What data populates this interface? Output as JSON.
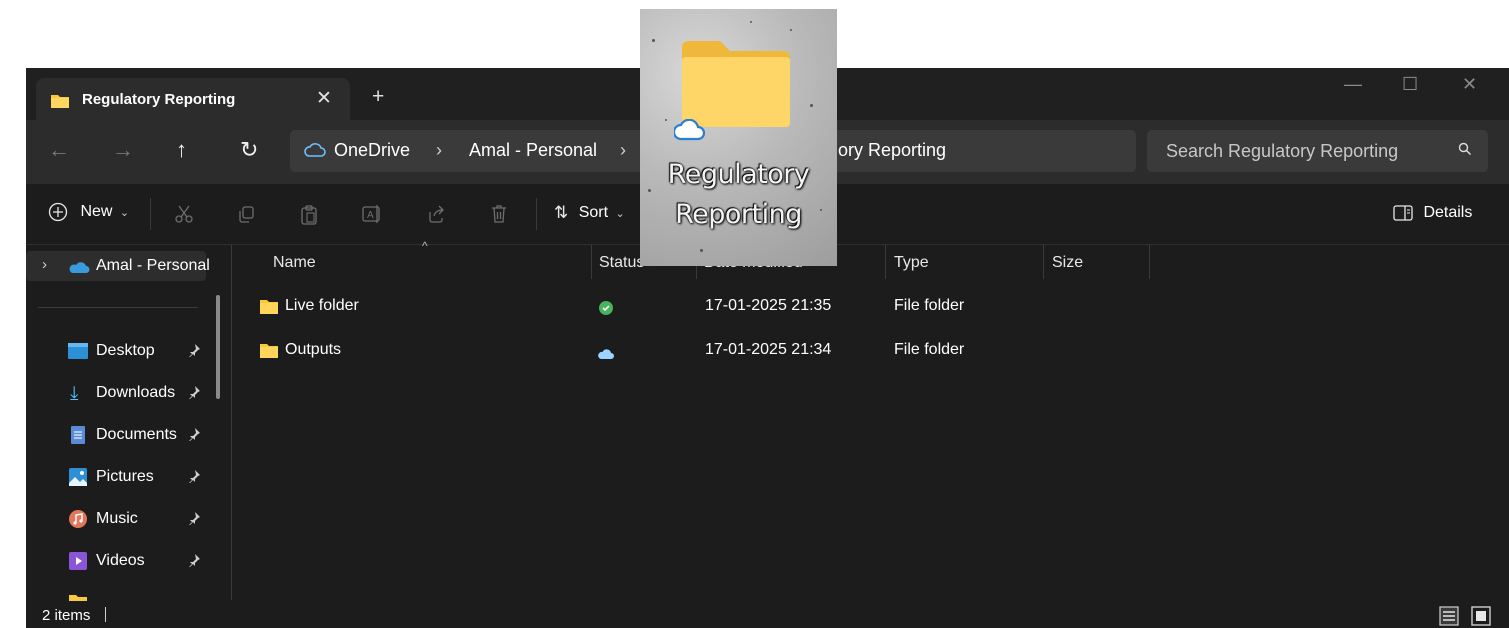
{
  "window": {
    "tab_title": "Regulatory Reporting",
    "icons": [
      "folder-icon",
      "close-icon",
      "plus-icon",
      "minimize-icon",
      "maximize-icon",
      "window-close-icon"
    ]
  },
  "address_bar": {
    "segments": [
      "OneDrive",
      "Amal - Personal",
      "Regulatory Reporting"
    ],
    "visible_tail": "ory Reporting"
  },
  "search": {
    "placeholder": "Search Regulatory Reporting"
  },
  "command_bar": {
    "new_label": "New",
    "sort_label": "Sort",
    "details_label": "Details"
  },
  "sidebar": {
    "onedrive_label": "Amal - Personal",
    "items": [
      {
        "label": "Desktop",
        "icon": "desktop-icon"
      },
      {
        "label": "Downloads",
        "icon": "download-icon"
      },
      {
        "label": "Documents",
        "icon": "documents-icon"
      },
      {
        "label": "Pictures",
        "icon": "pictures-icon"
      },
      {
        "label": "Music",
        "icon": "music-icon"
      },
      {
        "label": "Videos",
        "icon": "videos-icon"
      }
    ]
  },
  "columns": {
    "name": "Name",
    "status": "Status",
    "date_modified": "Date modified",
    "type": "Type",
    "size": "Size"
  },
  "rows": [
    {
      "name": "Live folder",
      "status": "available-offline",
      "date": "17-01-2025 21:35",
      "type": "File folder",
      "size": ""
    },
    {
      "name": "Outputs",
      "status": "online-only",
      "date": "17-01-2025 21:34",
      "type": "File folder",
      "size": ""
    }
  ],
  "status_bar": {
    "count_text": "2 items"
  },
  "floating_icon": {
    "line1": "Regulatory",
    "line2": "Reporting"
  },
  "colors": {
    "folder": "#f8c93b",
    "onedrive": "#3a9bdc",
    "synced": "#47b35c",
    "background": "#1c1c1c"
  }
}
